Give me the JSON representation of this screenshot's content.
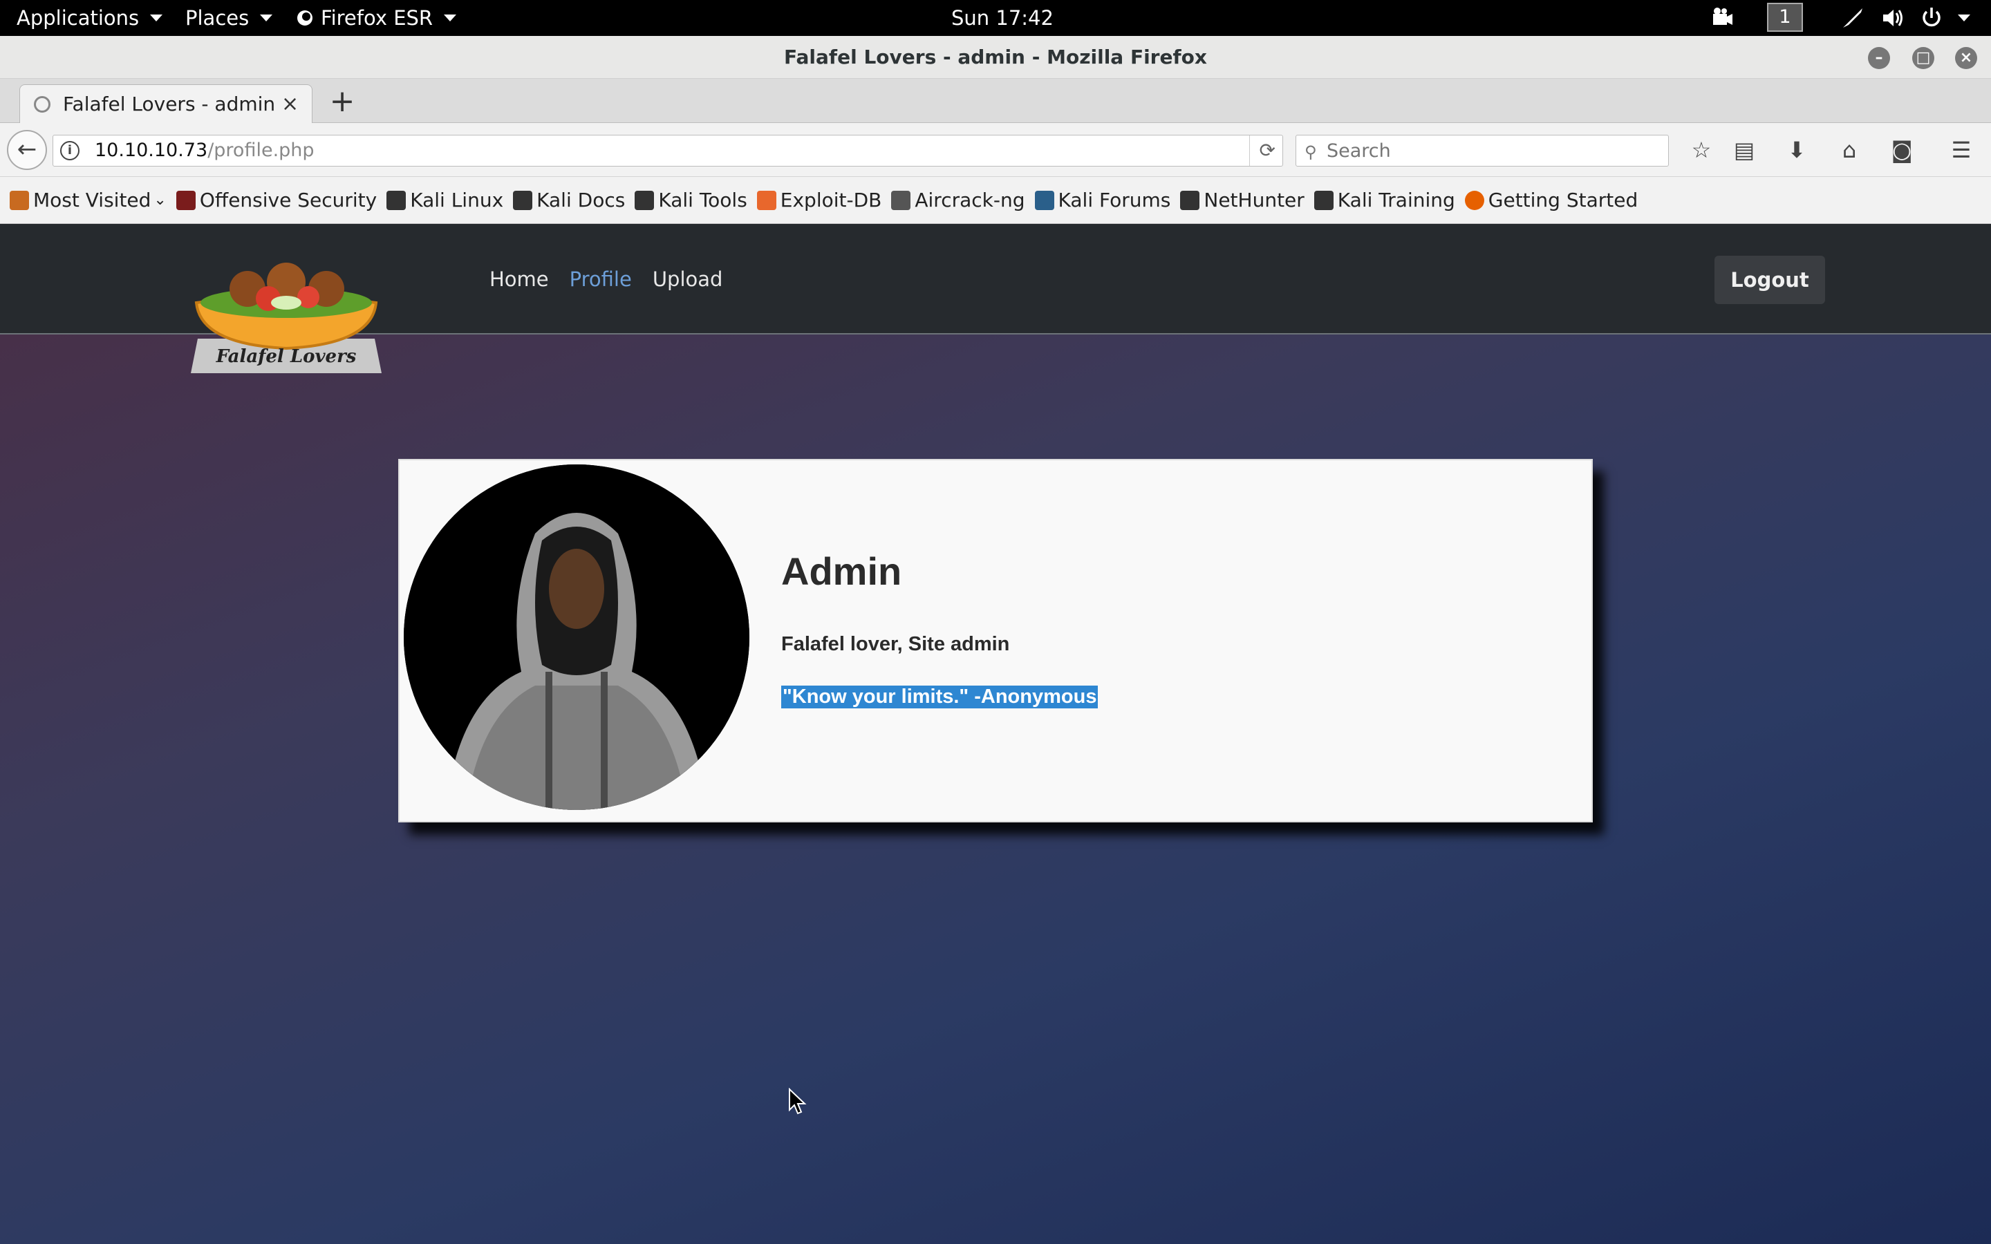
{
  "topbar": {
    "applications": "Applications",
    "places": "Places",
    "firefox": "Firefox ESR",
    "clock": "Sun 17:42",
    "workspace": "1"
  },
  "window": {
    "title": "Falafel Lovers - admin - Mozilla Firefox"
  },
  "tab": {
    "label": "Falafel Lovers - admin",
    "close": "×",
    "new": "+"
  },
  "nav": {
    "url_host": "10.10.10.73",
    "url_path": "/profile.php",
    "search_placeholder": "Search"
  },
  "bookmarks": [
    {
      "label": "Most Visited",
      "icon": "folder-icon",
      "color": "#c86a20"
    },
    {
      "label": "Offensive Security",
      "icon": "offsec-icon",
      "color": "#7a1c1c"
    },
    {
      "label": "Kali Linux",
      "icon": "kali-icon",
      "color": "#333333"
    },
    {
      "label": "Kali Docs",
      "icon": "kali-icon",
      "color": "#333333"
    },
    {
      "label": "Kali Tools",
      "icon": "kali-icon",
      "color": "#333333"
    },
    {
      "label": "Exploit-DB",
      "icon": "exploitdb-icon",
      "color": "#e8672c"
    },
    {
      "label": "Aircrack-ng",
      "icon": "aircrack-icon",
      "color": "#555555"
    },
    {
      "label": "Kali Forums",
      "icon": "forums-icon",
      "color": "#2a5f8a"
    },
    {
      "label": "NetHunter",
      "icon": "kali-icon",
      "color": "#333333"
    },
    {
      "label": "Kali Training",
      "icon": "kali-icon",
      "color": "#333333"
    },
    {
      "label": "Getting Started",
      "icon": "firefox-icon",
      "color": "#e66000"
    }
  ],
  "site": {
    "logo_text": "Falafel Lovers",
    "links": {
      "home": "Home",
      "profile": "Profile",
      "upload": "Upload"
    },
    "logout": "Logout",
    "accent": "#6d9fd8"
  },
  "profile": {
    "name": "Admin",
    "role": "Falafel lover, Site admin",
    "quote": "\"Know your limits.\" -Anonymous",
    "highlight": "#2e87d2"
  }
}
